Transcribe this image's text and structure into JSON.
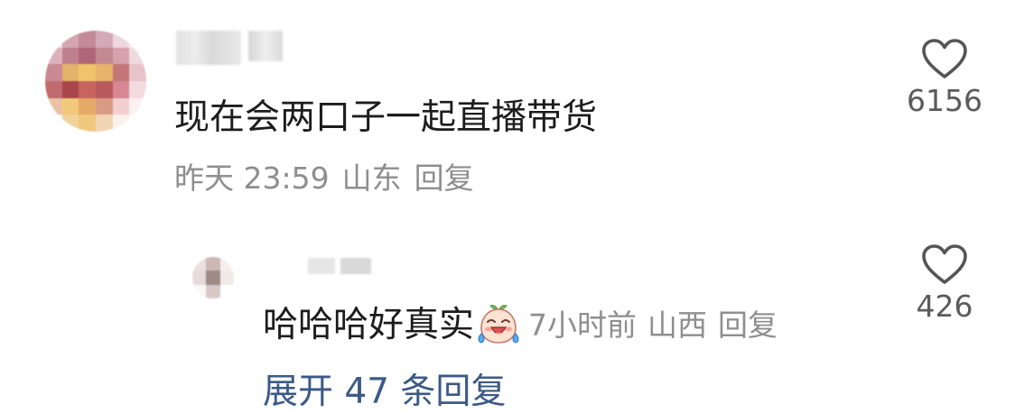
{
  "comment": {
    "text": "现在会两口子一起直播带货",
    "time": "昨天 23:59",
    "location": "山东",
    "reply_label": "回复",
    "like_count": "6156"
  },
  "reply": {
    "text": "哈哈哈好真实",
    "emoji": "crying-laughing-face",
    "time": "7小时前",
    "location": "山西",
    "reply_label": "回复",
    "like_count": "426"
  },
  "expand": {
    "label": "展开 47 条回复"
  },
  "colors": {
    "text_primary": "#1c1c1c",
    "text_meta": "#8e8e8e",
    "like_count": "#5b5b5b",
    "expand_link": "#3b5a86"
  }
}
